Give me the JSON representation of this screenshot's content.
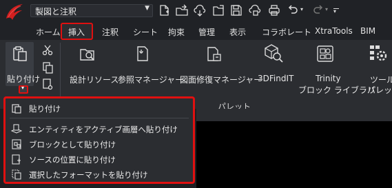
{
  "window": {
    "document_name": "製図と注釈"
  },
  "colors": {
    "highlight": "#e01010",
    "logo": "#d21f1f",
    "background": "#2b2d31"
  },
  "quick_access": {
    "icons": [
      "new-file-icon",
      "open-file-icon",
      "cloud-download-icon",
      "open-folder-icon",
      "save-icon",
      "cloud-upload-icon",
      "print-icon",
      "undo-icon",
      "redo-icon"
    ],
    "undo_chevron": "▾",
    "redo_chevron": "▾",
    "more": "▾"
  },
  "menu_tabs": [
    "ホーム",
    "挿入",
    "注釈",
    "シート",
    "拘束",
    "管理",
    "表示",
    "コラボレート",
    "XtraTools",
    "BIM"
  ],
  "ribbon": {
    "paste_label": "貼り付け",
    "paste_dropdown_glyph": "▾",
    "buttons": [
      {
        "label": "設計リソース",
        "icon": "design-resources-icon"
      },
      {
        "label": "参照マネージャー",
        "icon": "reference-manager-icon"
      },
      {
        "label": "図面修復マネージャー",
        "icon": "drawing-recovery-icon"
      },
      {
        "label": "3DFindIT",
        "icon": "3dfindit-icon"
      },
      {
        "label": "Trinity",
        "label2": "ブロック ライブラリ",
        "icon": "trinity-block-library-icon"
      },
      {
        "label": "ツール",
        "label2": "パレット",
        "icon": "tool-palette-icon"
      }
    ],
    "panel_label": "パレット"
  },
  "paste_menu": {
    "items": [
      {
        "label": "貼り付け",
        "icon": "paste-icon"
      },
      {
        "label": "エンティティをアクティブ画層へ貼り付け",
        "icon": "paste-to-active-layer-icon"
      },
      {
        "label": "ブロックとして貼り付け",
        "icon": "paste-as-block-icon"
      },
      {
        "label": "ソースの位置に貼り付け",
        "icon": "paste-to-original-coords-icon"
      },
      {
        "label": "選択したフォーマットを貼り付け",
        "icon": "paste-special-icon"
      }
    ]
  }
}
